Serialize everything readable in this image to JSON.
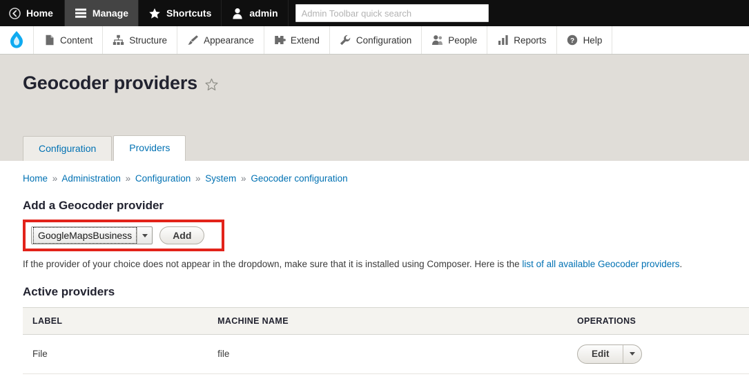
{
  "admin_toolbar": {
    "items": [
      {
        "label": "Home",
        "icon": "back-circle-icon",
        "active": false
      },
      {
        "label": "Manage",
        "icon": "hamburger-icon",
        "active": true
      },
      {
        "label": "Shortcuts",
        "icon": "star-icon",
        "active": false
      },
      {
        "label": "admin",
        "icon": "user-icon",
        "active": false
      }
    ],
    "search_placeholder": "Admin Toolbar quick search",
    "search_value": ""
  },
  "module_toolbar": {
    "logo": "drupal-droplet-icon",
    "items": [
      {
        "label": "Content",
        "icon": "file-icon"
      },
      {
        "label": "Structure",
        "icon": "structure-icon"
      },
      {
        "label": "Appearance",
        "icon": "paintbrush-icon"
      },
      {
        "label": "Extend",
        "icon": "puzzle-icon"
      },
      {
        "label": "Configuration",
        "icon": "wrench-icon"
      },
      {
        "label": "People",
        "icon": "people-icon"
      },
      {
        "label": "Reports",
        "icon": "bar-chart-icon"
      },
      {
        "label": "Help",
        "icon": "question-circle-icon"
      }
    ]
  },
  "page": {
    "title": "Geocoder providers",
    "title_star": "star-outline-icon",
    "tabs": [
      {
        "label": "Configuration",
        "active": false
      },
      {
        "label": "Providers",
        "active": true
      }
    ],
    "breadcrumb": [
      "Home",
      "Administration",
      "Configuration",
      "System",
      "Geocoder configuration"
    ],
    "breadcrumb_separator": "»"
  },
  "add_provider": {
    "heading": "Add a Geocoder provider",
    "selected_provider": "GoogleMapsBusiness",
    "add_button": "Add",
    "highlight_color": "#e2231a",
    "help_text_before": "If the provider of your choice does not appear in the dropdown, make sure that it is installed using Composer. Here is the ",
    "help_link": "list of all available Geocoder providers",
    "help_text_after": "."
  },
  "active_providers": {
    "heading": "Active providers",
    "columns": [
      "LABEL",
      "MACHINE NAME",
      "OPERATIONS"
    ],
    "rows": [
      {
        "label": "File",
        "machine_name": "file",
        "operation_label": "Edit",
        "operation_toggle": "chevron-down-icon"
      }
    ]
  }
}
